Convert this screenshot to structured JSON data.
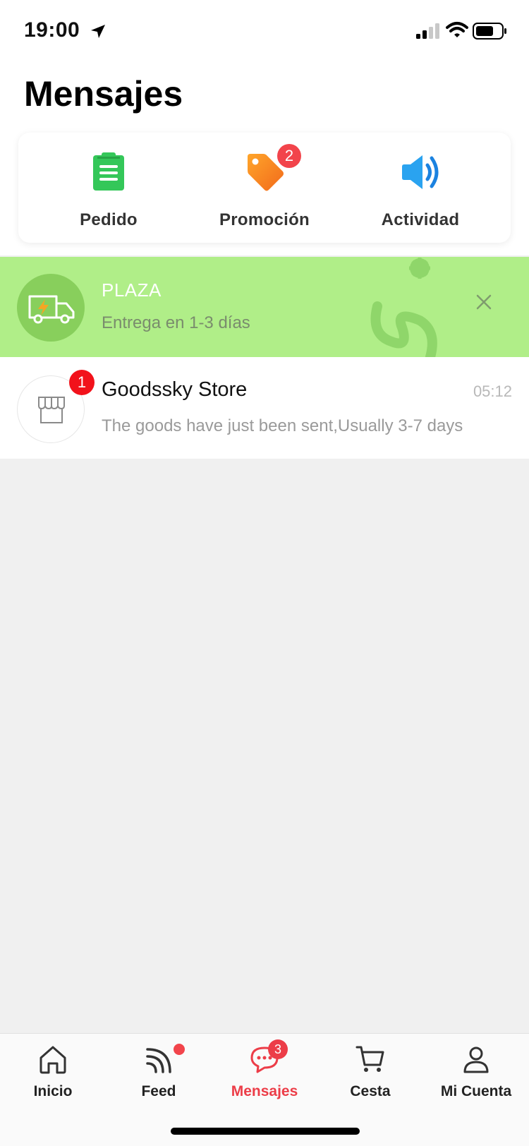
{
  "status_bar": {
    "time": "19:00"
  },
  "page": {
    "title": "Mensajes"
  },
  "categories": [
    {
      "label": "Pedido",
      "icon": "clipboard-icon",
      "badge": null
    },
    {
      "label": "Promoción",
      "icon": "tag-icon",
      "badge": "2"
    },
    {
      "label": "Actividad",
      "icon": "speaker-icon",
      "badge": null
    }
  ],
  "banner": {
    "title": "PLAZA",
    "subtitle": "Entrega en 1-3 días",
    "icon": "delivery-truck-icon",
    "bg_color": "#b0ee88"
  },
  "messages": [
    {
      "name": "Goodssky Store",
      "time": "05:12",
      "preview": "The goods have just been sent,Usually 3-7 days",
      "unread": "1",
      "icon": "store-icon"
    }
  ],
  "tabs": [
    {
      "label": "Inicio",
      "icon": "home-icon",
      "active": false
    },
    {
      "label": "Feed",
      "icon": "feed-icon",
      "active": false,
      "dot": true
    },
    {
      "label": "Mensajes",
      "icon": "chat-icon",
      "active": true,
      "badge": "3"
    },
    {
      "label": "Cesta",
      "icon": "cart-icon",
      "active": false
    },
    {
      "label": "Mi Cuenta",
      "icon": "user-icon",
      "active": false
    }
  ],
  "colors": {
    "accent": "#ec3d48",
    "badge": "#f2444b",
    "banner": "#b0ee88"
  }
}
